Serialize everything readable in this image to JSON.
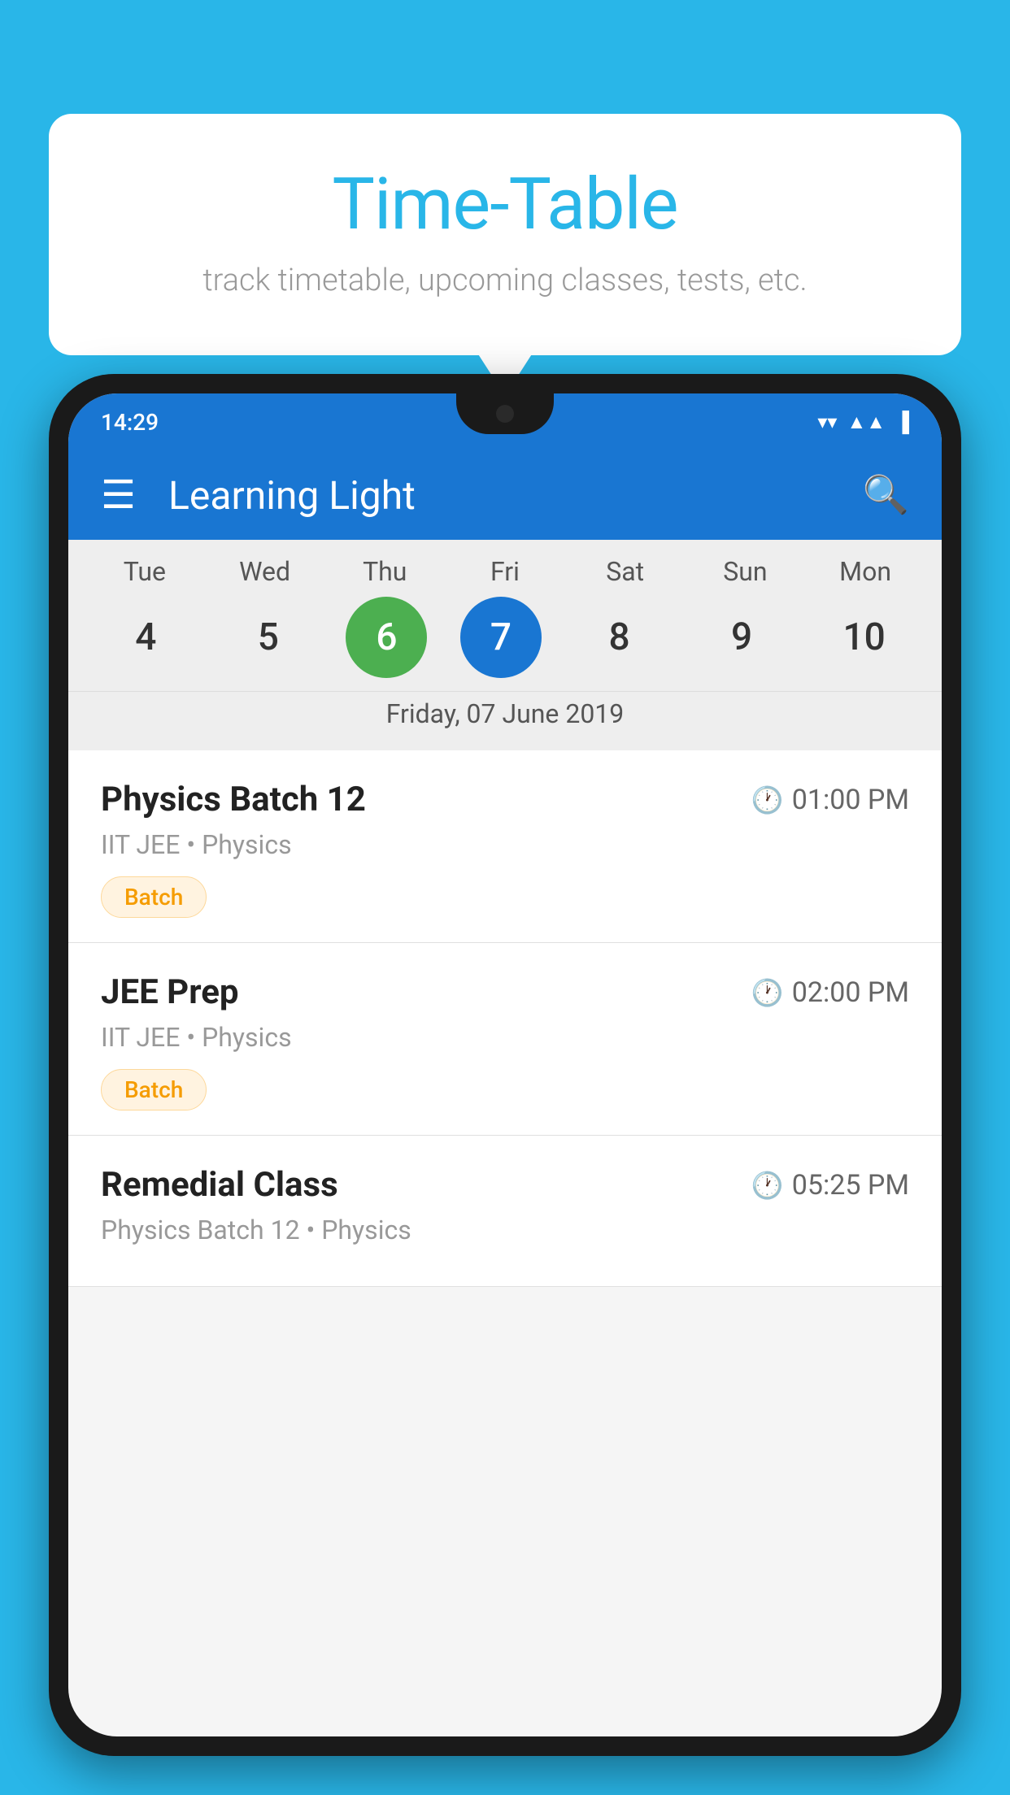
{
  "background_color": "#29b6e8",
  "bubble": {
    "title": "Time-Table",
    "subtitle": "track timetable, upcoming classes, tests, etc."
  },
  "phone": {
    "status_bar": {
      "time": "14:29",
      "wifi": "▼",
      "signal": "▲",
      "battery": "▌"
    },
    "app_bar": {
      "title": "Learning Light",
      "menu_icon": "☰",
      "search_icon": "🔍"
    },
    "calendar": {
      "day_headers": [
        "Tue",
        "Wed",
        "Thu",
        "Fri",
        "Sat",
        "Sun",
        "Mon"
      ],
      "day_numbers": [
        "4",
        "5",
        "6",
        "7",
        "8",
        "9",
        "10"
      ],
      "today_index": 2,
      "selected_index": 3,
      "selected_date_label": "Friday, 07 June 2019"
    },
    "schedule": [
      {
        "title": "Physics Batch 12",
        "time": "01:00 PM",
        "subtitle": "IIT JEE • Physics",
        "tag": "Batch"
      },
      {
        "title": "JEE Prep",
        "time": "02:00 PM",
        "subtitle": "IIT JEE • Physics",
        "tag": "Batch"
      },
      {
        "title": "Remedial Class",
        "time": "05:25 PM",
        "subtitle": "Physics Batch 12 • Physics",
        "tag": ""
      }
    ]
  }
}
